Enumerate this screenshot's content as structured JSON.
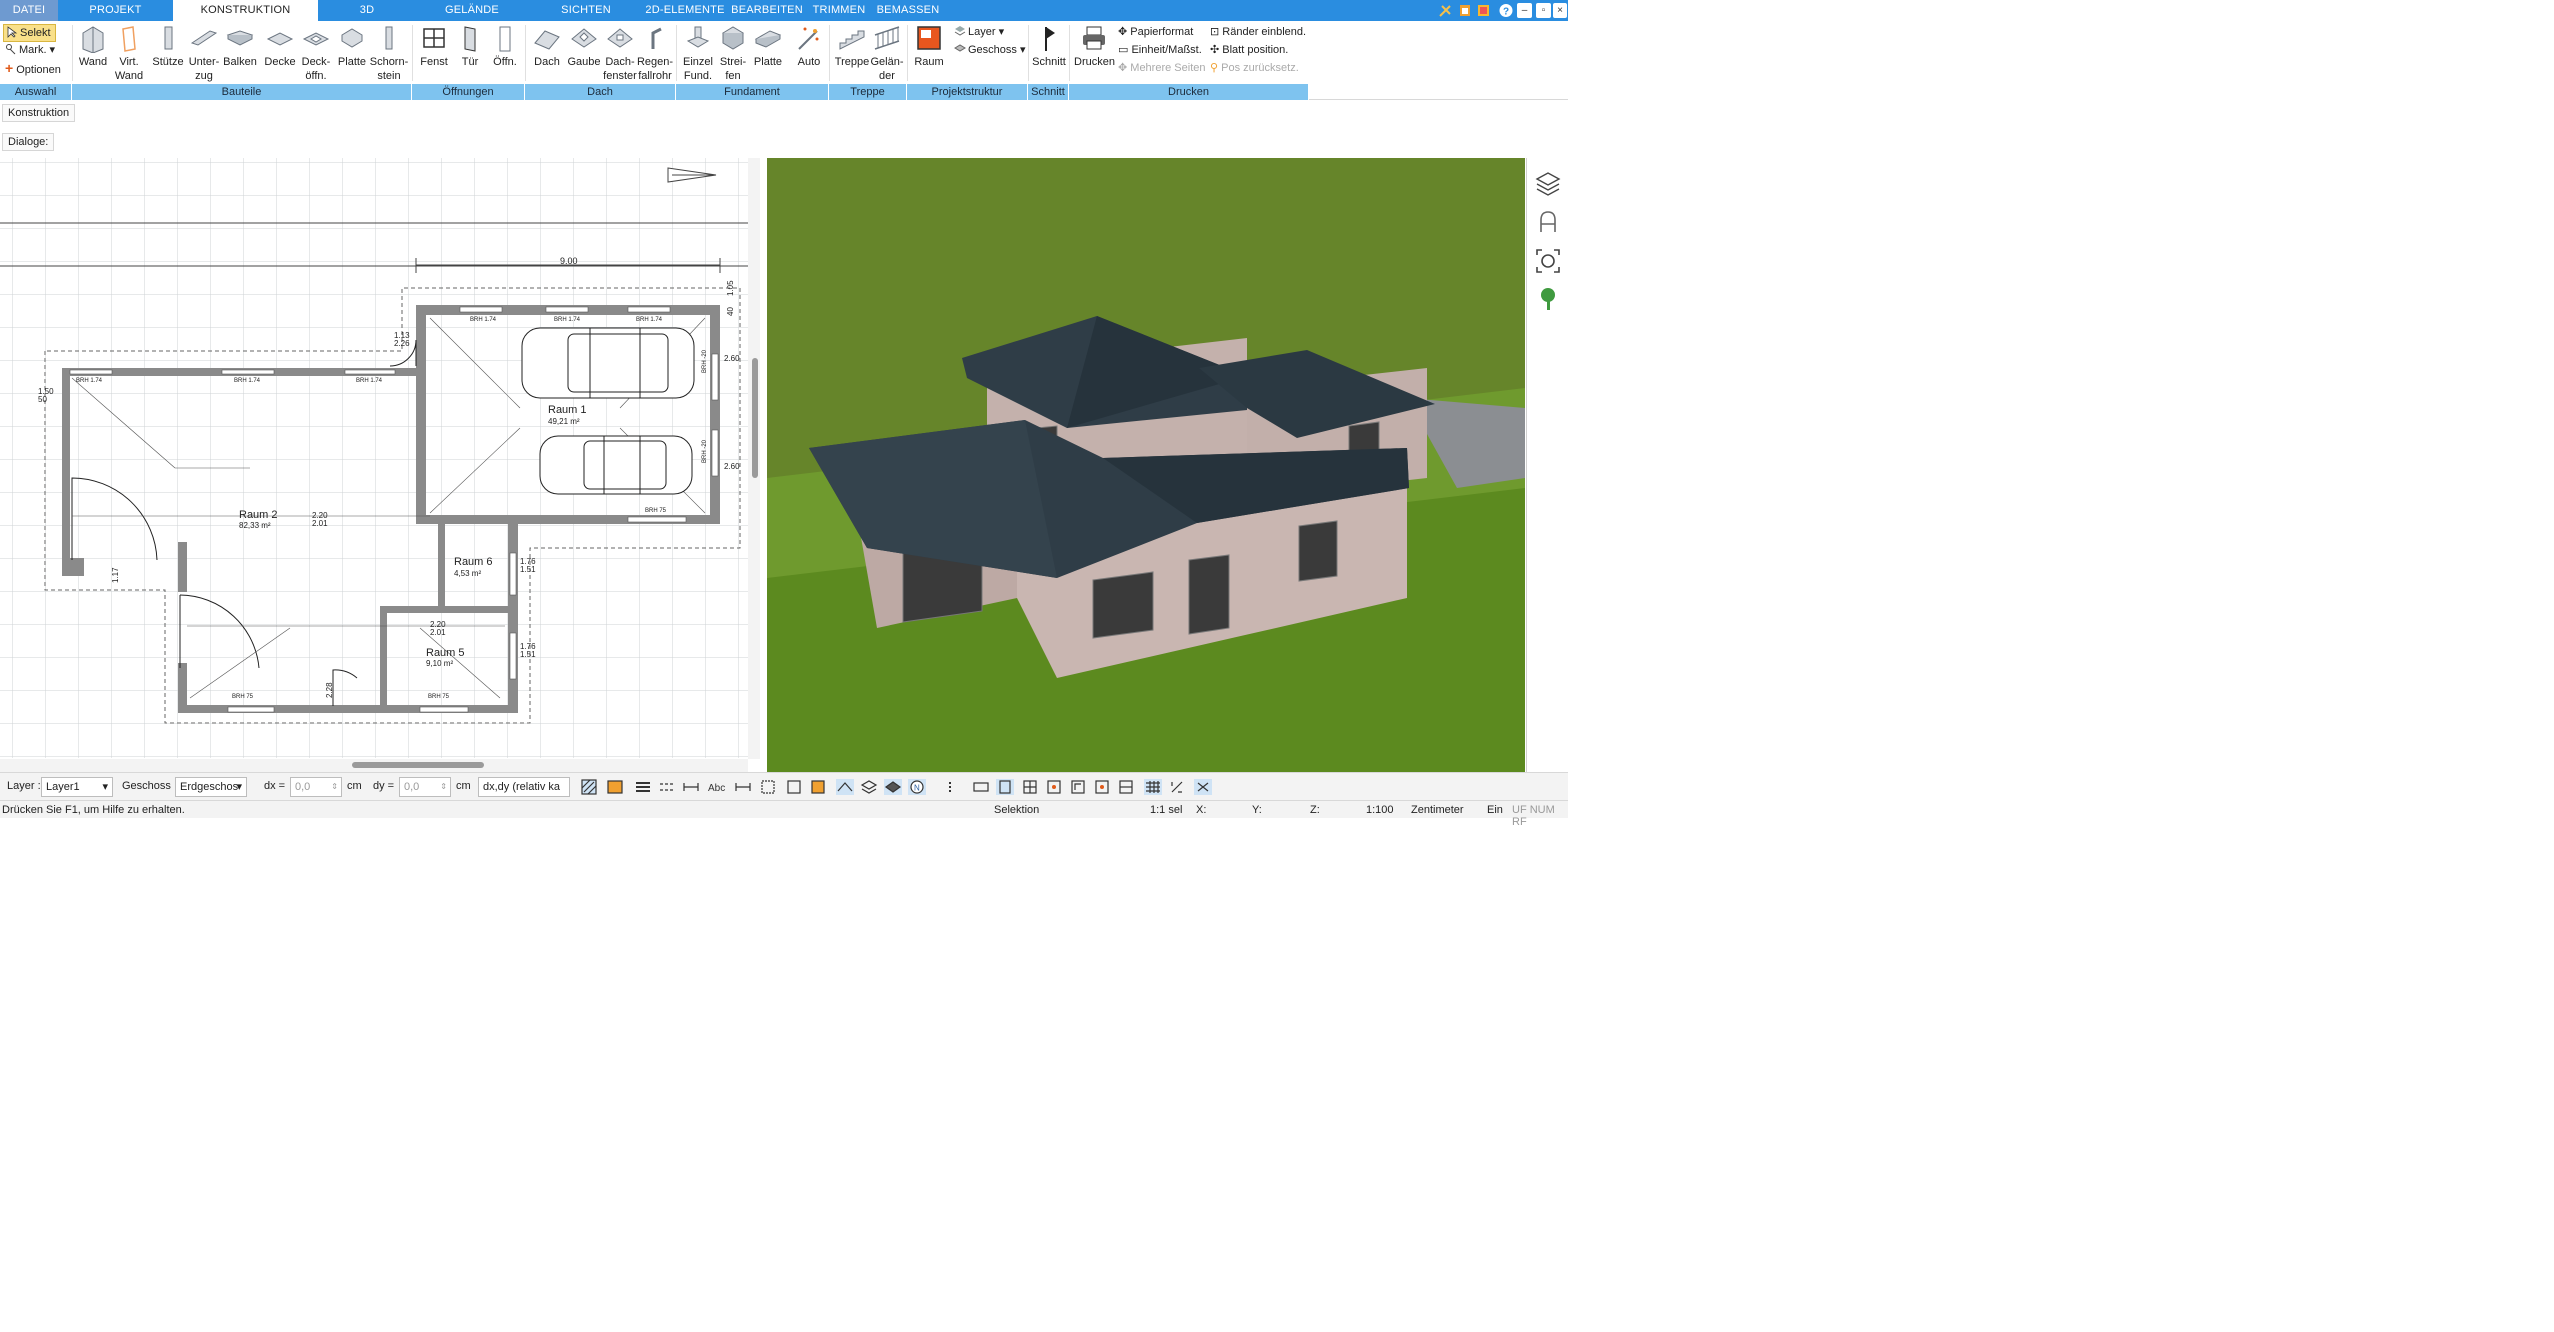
{
  "menu_tabs": [
    "DATEI",
    "PROJEKT",
    "KONSTRUKTION",
    "3D",
    "GELÄNDE",
    "SICHTEN",
    "2D-ELEMENTE",
    "BEARBEITEN",
    "TRIMMEN",
    "BEMASSEN"
  ],
  "active_tab": "KONSTRUKTION",
  "ribbon": {
    "auswahl": {
      "selekt": "Selekt",
      "mark": "Mark.",
      "optionen": "Optionen"
    },
    "bauteile": [
      {
        "line1": "Wand",
        "line2": ""
      },
      {
        "line1": "Virt.",
        "line2": "Wand"
      },
      {
        "line1": "Stütze",
        "line2": ""
      },
      {
        "line1": "Unter-",
        "line2": "zug"
      },
      {
        "line1": "Balken",
        "line2": ""
      },
      {
        "line1": "Decke",
        "line2": ""
      },
      {
        "line1": "Deck-",
        "line2": "öffn."
      },
      {
        "line1": "Platte",
        "line2": ""
      },
      {
        "line1": "Schorn-",
        "line2": "stein"
      }
    ],
    "oeffnungen": [
      {
        "line1": "Fenst",
        "line2": ""
      },
      {
        "line1": "Tür",
        "line2": ""
      },
      {
        "line1": "Öffn.",
        "line2": ""
      }
    ],
    "dach": [
      {
        "line1": "Dach",
        "line2": ""
      },
      {
        "line1": "Gaube",
        "line2": ""
      },
      {
        "line1": "Dach-",
        "line2": "fenster"
      },
      {
        "line1": "Regen-",
        "line2": "fallrohr"
      }
    ],
    "fundament": [
      {
        "line1": "Einzel",
        "line2": "Fund."
      },
      {
        "line1": "Strei-",
        "line2": "fen"
      },
      {
        "line1": "Platte",
        "line2": ""
      },
      {
        "line1": "Auto",
        "line2": ""
      }
    ],
    "treppe": [
      {
        "line1": "Treppe",
        "line2": ""
      },
      {
        "line1": "Gelän-",
        "line2": "der"
      }
    ],
    "projektstruktur": {
      "raum": "Raum",
      "layer": "Layer",
      "geschoss": "Geschoss"
    },
    "schnitt": "Schnitt",
    "drucken": {
      "drucken": "Drucken",
      "papierformat": "Papierformat",
      "einheit": "Einheit/Maßst.",
      "mehrere": "Mehrere Seiten",
      "raender": "Ränder einblend.",
      "blatt": "Blatt position.",
      "pos": "Pos zurücksetz."
    },
    "groups": [
      "Auswahl",
      "Bauteile",
      "Öffnungen",
      "Dach",
      "Fundament",
      "Treppe",
      "Projektstruktur",
      "Schnitt",
      "Drucken"
    ]
  },
  "subbar": {
    "konstruktion": "Konstruktion",
    "dialoge": "Dialoge:"
  },
  "plan": {
    "dims": {
      "top": "9.00",
      "d105": "1.05",
      "d40": "40"
    },
    "rooms": [
      {
        "name": "Raum 1",
        "area": "49,21 m²"
      },
      {
        "name": "Raum 2",
        "area": "82,33 m²"
      },
      {
        "name": "Raum 6",
        "area": "4,53 m²"
      },
      {
        "name": "Raum 5",
        "area": "9,10 m²"
      }
    ],
    "brh": [
      "BRH 1.74",
      "BRH 75",
      "BRH -20"
    ],
    "marks": [
      "1.50",
      "50",
      "1.13",
      "2.26",
      "2.60",
      "2.20",
      "2.01",
      "1.76",
      "1.51",
      "2.28",
      "1.17"
    ]
  },
  "colors": {
    "tab_blue": "#2a8de0",
    "group_blue": "#7ec3ef",
    "roof": "#2c3a44",
    "wall": "#c9b8b4",
    "grass": "#6c8f2f"
  },
  "bottom": {
    "layer_label": "Layer :",
    "layer_value": "Layer1",
    "geschoss_label": "Geschoss :",
    "geschoss_value": "Erdgeschos",
    "dx_label": "dx =",
    "dx_value": "0,0",
    "dy_label": "dy =",
    "dy_value": "0,0",
    "unit": "cm",
    "mode": "dx,dy (relativ ka"
  },
  "status": {
    "help": "Drücken Sie F1, um Hilfe zu erhalten.",
    "selektion": "Selektion",
    "sel": "1:1 sel",
    "x": "X:",
    "y": "Y:",
    "z": "Z:",
    "scale": "1:100",
    "unit": "Zentimeter",
    "ein": "Ein",
    "flags": "UF NUM RF"
  }
}
